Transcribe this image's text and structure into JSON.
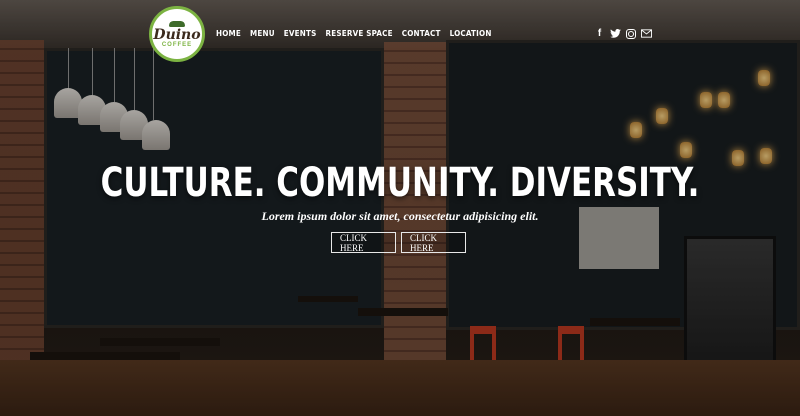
{
  "brand": {
    "logo_word": "Duino",
    "logo_sub": "COFFEE"
  },
  "nav": {
    "items": [
      {
        "label": "HOME"
      },
      {
        "label": "MENU"
      },
      {
        "label": "EVENTS"
      },
      {
        "label": "RESERVE SPACE"
      },
      {
        "label": "CONTACT"
      },
      {
        "label": "LOCATION"
      }
    ]
  },
  "social": {
    "icons": [
      "facebook-icon",
      "twitter-icon",
      "instagram-icon",
      "email-icon"
    ],
    "facebook_glyph": "f",
    "twitter_glyph": "🐦"
  },
  "hero": {
    "title": "CULTURE. COMMUNITY. DIVERSITY.",
    "subtitle": "Lorem ipsum dolor sit amet, consectetur adipisicing elit.",
    "button1": "CLICK HERE",
    "button2": "CLICK HERE"
  },
  "colors": {
    "accent_green": "#7cb342",
    "text": "#ffffff"
  }
}
